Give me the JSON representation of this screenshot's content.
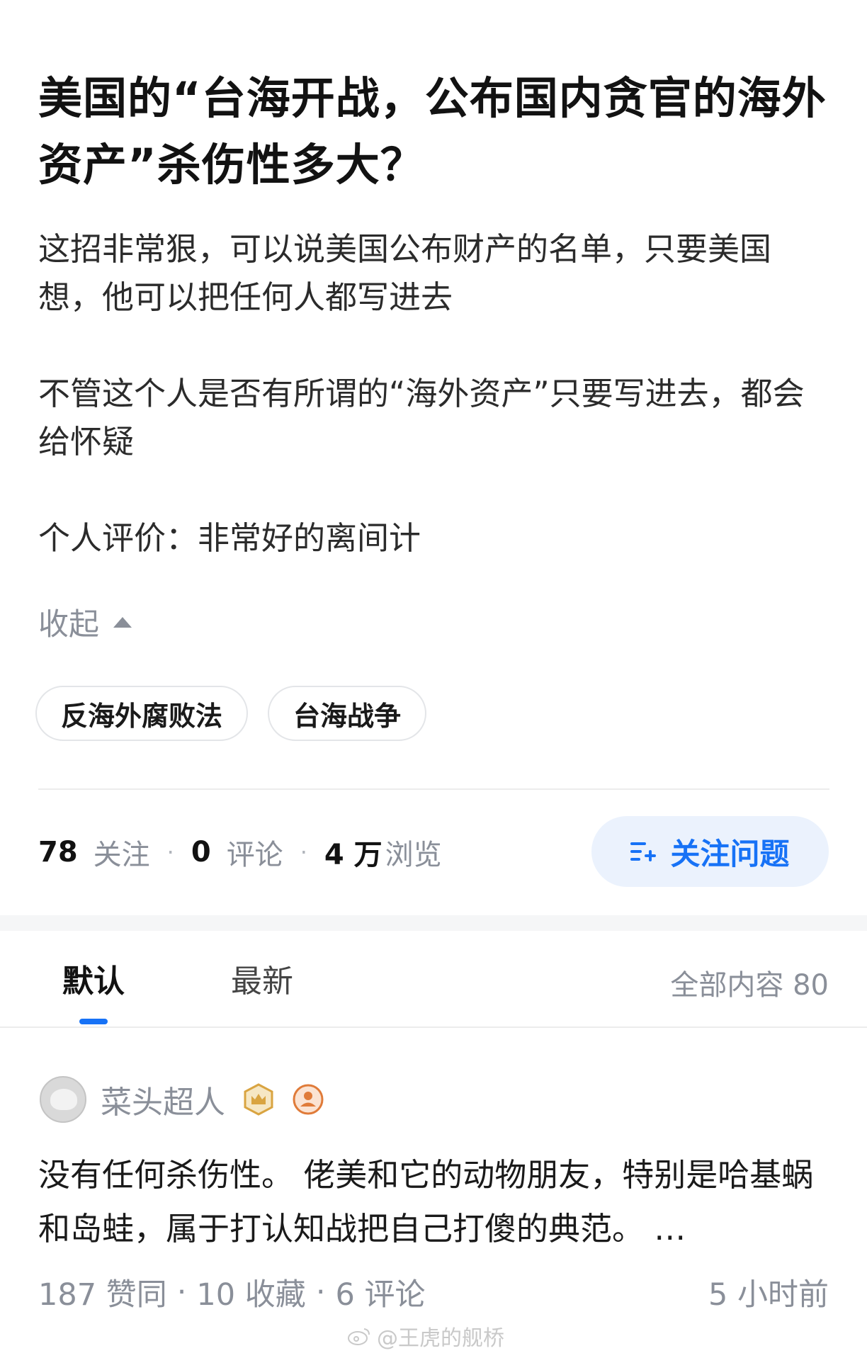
{
  "question": {
    "title": "美国的“台海开战，公布国内贪官的海外资产”杀伤性多大？",
    "body_paragraphs": [
      "这招非常狠，可以说美国公布财产的名单，只要美国想，他可以把任何人都写进去",
      "不管这个人是否有所谓的“海外资产”只要写进去，都会给怀疑",
      "个人评价：非常好的离间计"
    ],
    "collapse_label": "收起",
    "tags": [
      "反海外腐败法",
      "台海战争"
    ],
    "stats": {
      "followers_count": "78",
      "followers_label": "关注",
      "comments_count": "0",
      "comments_label": "评论",
      "views_count": "4 万",
      "views_label": "浏览"
    },
    "follow_button_label": "关注问题"
  },
  "tabs": {
    "default_label": "默认",
    "newest_label": "最新",
    "total_label": "全部内容 80"
  },
  "answer": {
    "author_name": "菜头超人",
    "text": "没有任何杀伤性。 佬美和它的动物朋友，特别是哈基蜗和岛蛙，属于打认知战把自己打傻的典范。 …",
    "likes": "187 赞同",
    "favorites": "10 收藏",
    "comments": "6 评论",
    "time": "5 小时前"
  },
  "watermark": "@王虎的舰桥",
  "colors": {
    "accent": "#1772f6",
    "button_bg": "#ebf2fd",
    "muted": "#8a8f99",
    "badge_gold": "#d9a441",
    "badge_orange": "#e07b39"
  },
  "icons": {
    "collapse": "triangle-up-icon",
    "follow": "follow-list-plus-icon",
    "badge1": "crown-hexagon-icon",
    "badge2": "person-circle-icon",
    "watermark": "weibo-icon"
  }
}
